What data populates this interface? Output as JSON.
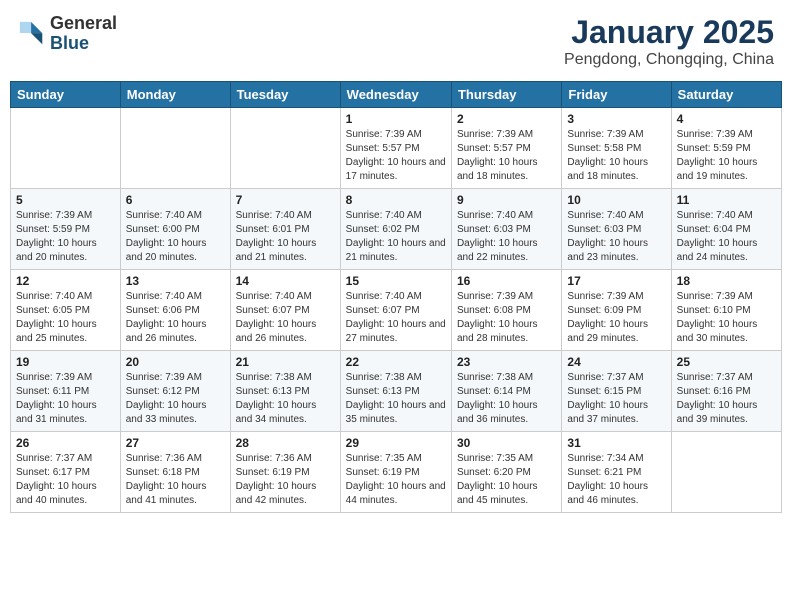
{
  "header": {
    "logo_general": "General",
    "logo_blue": "Blue",
    "month": "January 2025",
    "location": "Pengdong, Chongqing, China"
  },
  "weekdays": [
    "Sunday",
    "Monday",
    "Tuesday",
    "Wednesday",
    "Thursday",
    "Friday",
    "Saturday"
  ],
  "weeks": [
    [
      {
        "day": null,
        "info": null
      },
      {
        "day": null,
        "info": null
      },
      {
        "day": null,
        "info": null
      },
      {
        "day": "1",
        "info": "Sunrise: 7:39 AM\nSunset: 5:57 PM\nDaylight: 10 hours and 17 minutes."
      },
      {
        "day": "2",
        "info": "Sunrise: 7:39 AM\nSunset: 5:57 PM\nDaylight: 10 hours and 18 minutes."
      },
      {
        "day": "3",
        "info": "Sunrise: 7:39 AM\nSunset: 5:58 PM\nDaylight: 10 hours and 18 minutes."
      },
      {
        "day": "4",
        "info": "Sunrise: 7:39 AM\nSunset: 5:59 PM\nDaylight: 10 hours and 19 minutes."
      }
    ],
    [
      {
        "day": "5",
        "info": "Sunrise: 7:39 AM\nSunset: 5:59 PM\nDaylight: 10 hours and 20 minutes."
      },
      {
        "day": "6",
        "info": "Sunrise: 7:40 AM\nSunset: 6:00 PM\nDaylight: 10 hours and 20 minutes."
      },
      {
        "day": "7",
        "info": "Sunrise: 7:40 AM\nSunset: 6:01 PM\nDaylight: 10 hours and 21 minutes."
      },
      {
        "day": "8",
        "info": "Sunrise: 7:40 AM\nSunset: 6:02 PM\nDaylight: 10 hours and 21 minutes."
      },
      {
        "day": "9",
        "info": "Sunrise: 7:40 AM\nSunset: 6:03 PM\nDaylight: 10 hours and 22 minutes."
      },
      {
        "day": "10",
        "info": "Sunrise: 7:40 AM\nSunset: 6:03 PM\nDaylight: 10 hours and 23 minutes."
      },
      {
        "day": "11",
        "info": "Sunrise: 7:40 AM\nSunset: 6:04 PM\nDaylight: 10 hours and 24 minutes."
      }
    ],
    [
      {
        "day": "12",
        "info": "Sunrise: 7:40 AM\nSunset: 6:05 PM\nDaylight: 10 hours and 25 minutes."
      },
      {
        "day": "13",
        "info": "Sunrise: 7:40 AM\nSunset: 6:06 PM\nDaylight: 10 hours and 26 minutes."
      },
      {
        "day": "14",
        "info": "Sunrise: 7:40 AM\nSunset: 6:07 PM\nDaylight: 10 hours and 26 minutes."
      },
      {
        "day": "15",
        "info": "Sunrise: 7:40 AM\nSunset: 6:07 PM\nDaylight: 10 hours and 27 minutes."
      },
      {
        "day": "16",
        "info": "Sunrise: 7:39 AM\nSunset: 6:08 PM\nDaylight: 10 hours and 28 minutes."
      },
      {
        "day": "17",
        "info": "Sunrise: 7:39 AM\nSunset: 6:09 PM\nDaylight: 10 hours and 29 minutes."
      },
      {
        "day": "18",
        "info": "Sunrise: 7:39 AM\nSunset: 6:10 PM\nDaylight: 10 hours and 30 minutes."
      }
    ],
    [
      {
        "day": "19",
        "info": "Sunrise: 7:39 AM\nSunset: 6:11 PM\nDaylight: 10 hours and 31 minutes."
      },
      {
        "day": "20",
        "info": "Sunrise: 7:39 AM\nSunset: 6:12 PM\nDaylight: 10 hours and 33 minutes."
      },
      {
        "day": "21",
        "info": "Sunrise: 7:38 AM\nSunset: 6:13 PM\nDaylight: 10 hours and 34 minutes."
      },
      {
        "day": "22",
        "info": "Sunrise: 7:38 AM\nSunset: 6:13 PM\nDaylight: 10 hours and 35 minutes."
      },
      {
        "day": "23",
        "info": "Sunrise: 7:38 AM\nSunset: 6:14 PM\nDaylight: 10 hours and 36 minutes."
      },
      {
        "day": "24",
        "info": "Sunrise: 7:37 AM\nSunset: 6:15 PM\nDaylight: 10 hours and 37 minutes."
      },
      {
        "day": "25",
        "info": "Sunrise: 7:37 AM\nSunset: 6:16 PM\nDaylight: 10 hours and 39 minutes."
      }
    ],
    [
      {
        "day": "26",
        "info": "Sunrise: 7:37 AM\nSunset: 6:17 PM\nDaylight: 10 hours and 40 minutes."
      },
      {
        "day": "27",
        "info": "Sunrise: 7:36 AM\nSunset: 6:18 PM\nDaylight: 10 hours and 41 minutes."
      },
      {
        "day": "28",
        "info": "Sunrise: 7:36 AM\nSunset: 6:19 PM\nDaylight: 10 hours and 42 minutes."
      },
      {
        "day": "29",
        "info": "Sunrise: 7:35 AM\nSunset: 6:19 PM\nDaylight: 10 hours and 44 minutes."
      },
      {
        "day": "30",
        "info": "Sunrise: 7:35 AM\nSunset: 6:20 PM\nDaylight: 10 hours and 45 minutes."
      },
      {
        "day": "31",
        "info": "Sunrise: 7:34 AM\nSunset: 6:21 PM\nDaylight: 10 hours and 46 minutes."
      },
      {
        "day": null,
        "info": null
      }
    ]
  ]
}
